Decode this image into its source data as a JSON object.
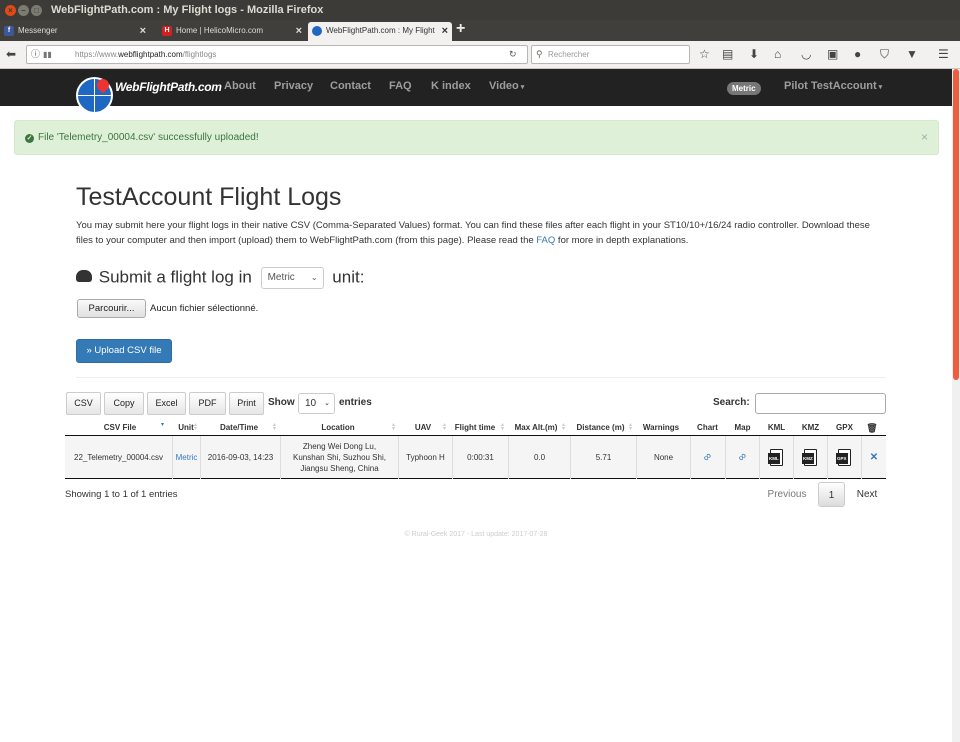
{
  "window": {
    "title": "WebFlightPath.com : My Flight logs - Mozilla Firefox"
  },
  "tabs": [
    {
      "label": "Messenger",
      "favicon": "f",
      "color": "#3b5998"
    },
    {
      "label": "Home | HelicoMicro.com",
      "favicon": "H",
      "color": "#d02020"
    },
    {
      "label": "WebFlightPath.com : My Flight",
      "favicon": "globe",
      "color": "#1e68c3"
    }
  ],
  "browser": {
    "url_host": "https://www.webflightpath.com",
    "url_host_bold": "webflightpath.com",
    "url_prefix": "https://www.",
    "url_path": "/flightlogs",
    "search_placeholder": "Rechercher"
  },
  "site": {
    "brand": "WebFlightPath.com",
    "nav": [
      "About",
      "Privacy",
      "Contact",
      "FAQ",
      "K index",
      "Video"
    ],
    "unit_badge": "Metric",
    "user_menu": "Pilot TestAccount"
  },
  "alert": {
    "message": "File 'Telemetry_00004.csv' successfully uploaded!",
    "close": "×"
  },
  "page": {
    "title": "TestAccount Flight Logs",
    "intro_1": "You may submit here your flight logs in their native CSV (Comma-Separated Values) format. You can find these files after each flight in your ST10/10+/16/24 radio controller. Download these files to your computer and then import (upload) them to WebFlightPath.com (from this page). Please read the ",
    "intro_link": "FAQ",
    "intro_2": " for more in depth explanations."
  },
  "submit": {
    "prefix": "Submit a flight log in",
    "unit": "Metric",
    "suffix": "unit:",
    "browse_label": "Parcourir...",
    "no_file": "Aucun fichier sélectionné.",
    "upload_label": "» Upload CSV file"
  },
  "table_tools": {
    "buttons": [
      "CSV",
      "Copy",
      "Excel",
      "PDF",
      "Print"
    ],
    "show_label": "Show",
    "entries_value": "10",
    "entries_label": "entries",
    "search_label": "Search:"
  },
  "table": {
    "columns": [
      "CSV File",
      "Unit",
      "Date/Time",
      "Location",
      "UAV",
      "Flight time",
      "Max Alt.(m)",
      "Distance (m)",
      "Warnings",
      "Chart",
      "Map",
      "KML",
      "KMZ",
      "GPX"
    ],
    "rows": [
      {
        "csv_file": "22_Telemetry_00004.csv",
        "unit": "Metric",
        "datetime": "2016-09-03, 14:23",
        "location_1": "Zheng Wei Dong Lu,",
        "location_2": "Kunshan Shi, Suzhou Shi,",
        "location_3": "Jiangsu Sheng, China",
        "uav": "Typhoon H",
        "flight_time": "0:00:31",
        "max_alt": "0.0",
        "distance": "5.71",
        "warnings": "None",
        "kml": "KML",
        "kmz": "KMZ",
        "gpx": "GPX"
      }
    ]
  },
  "pagination": {
    "info": "Showing 1 to 1 of 1 entries",
    "previous": "Previous",
    "current": "1",
    "next": "Next"
  },
  "footer": "© Rural-Geek 2017 - Last update: 2017-07-28"
}
